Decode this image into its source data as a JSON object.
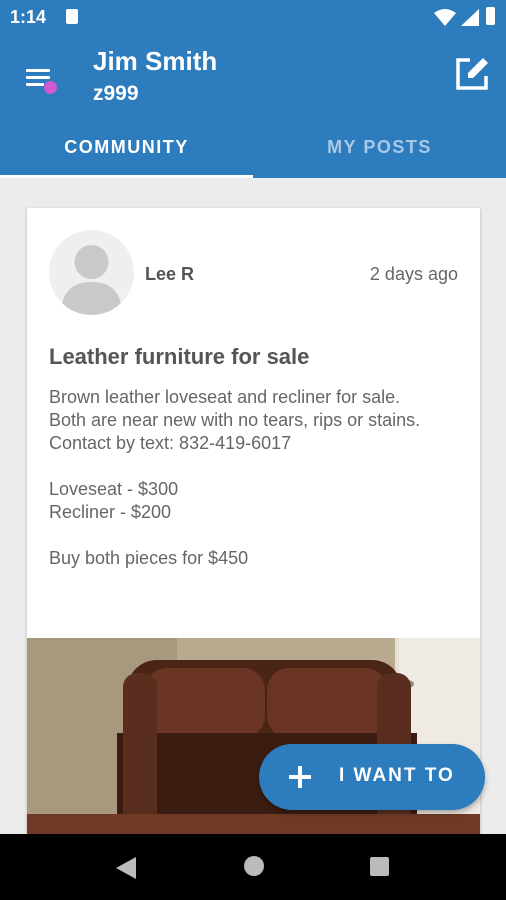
{
  "status_bar": {
    "time": "1:14"
  },
  "header": {
    "user_name": "Jim Smith",
    "user_id": "z999"
  },
  "tabs": [
    {
      "label": "COMMUNITY",
      "active": true
    },
    {
      "label": "MY POSTS",
      "active": false
    }
  ],
  "post": {
    "author": "Lee R",
    "time_ago": "2 days ago",
    "title": "Leather furniture for sale",
    "body_lines": [
      "Brown leather loveseat and recliner for sale.",
      "Both are near new with no tears, rips or stains.",
      "Contact by text: 832-419-6017",
      "",
      "Loveseat - $300",
      "Recliner - $200",
      "",
      "Buy both pieces for $450"
    ]
  },
  "fab": {
    "label": "I WANT TO"
  },
  "colors": {
    "primary": "#2d7cbd",
    "notification_dot": "#d05bd1",
    "background": "#ececec"
  },
  "icons": [
    "sd-card-icon",
    "wifi-icon",
    "signal-icon",
    "battery-icon",
    "menu-icon",
    "edit-icon",
    "avatar-icon",
    "plus-icon",
    "back-icon",
    "home-icon",
    "recents-icon"
  ]
}
